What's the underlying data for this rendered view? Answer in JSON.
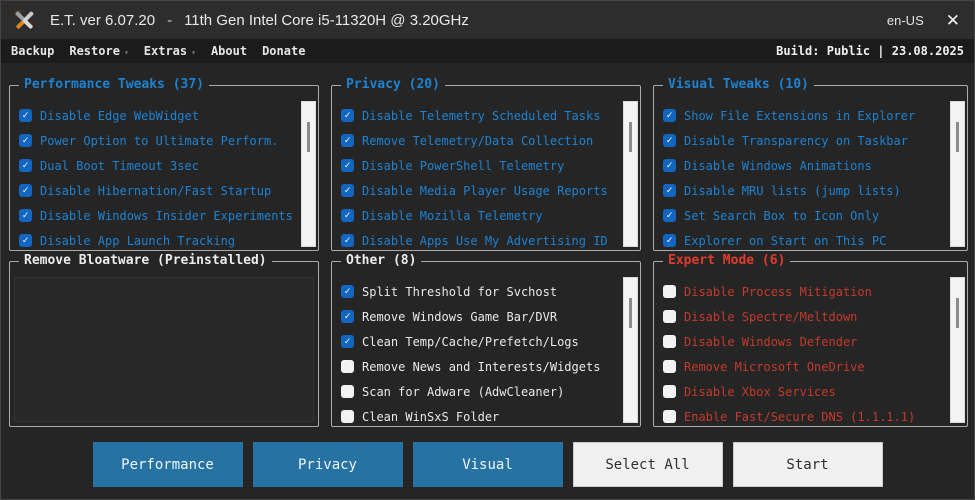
{
  "titlebar": {
    "app_title": "E.T. ver 6.07.20",
    "separator": "-",
    "cpu_info": "11th Gen Intel Core i5-11320H @ 3.20GHz",
    "language": "en-US",
    "close_icon": "✕",
    "app_icon": "crossed-tools-icon"
  },
  "menubar": {
    "items": [
      {
        "label": "Backup",
        "caret": ""
      },
      {
        "label": "Restore",
        "caret": "▾"
      },
      {
        "label": "Extras",
        "caret": "▾"
      },
      {
        "label": "About",
        "caret": ""
      },
      {
        "label": "Donate",
        "caret": ""
      }
    ],
    "build_info": "Build: Public | 23.08.2025"
  },
  "groups": [
    {
      "id": "performance-tweaks",
      "title": "Performance Tweaks (37)",
      "theme": "blue",
      "scrollbar": true,
      "listbox": false,
      "items": [
        {
          "label": "Disable Edge WebWidget",
          "checked": true
        },
        {
          "label": "Power Option to Ultimate Perform.",
          "checked": true
        },
        {
          "label": "Dual Boot Timeout 3sec",
          "checked": true
        },
        {
          "label": "Disable Hibernation/Fast Startup",
          "checked": true
        },
        {
          "label": "Disable Windows Insider Experiments",
          "checked": true
        },
        {
          "label": "Disable App Launch Tracking",
          "checked": true
        }
      ]
    },
    {
      "id": "privacy",
      "title": "Privacy (20)",
      "theme": "blue",
      "scrollbar": true,
      "listbox": false,
      "items": [
        {
          "label": "Disable Telemetry Scheduled Tasks",
          "checked": true
        },
        {
          "label": "Remove Telemetry/Data Collection",
          "checked": true
        },
        {
          "label": "Disable PowerShell Telemetry",
          "checked": true
        },
        {
          "label": "Disable Media Player Usage Reports",
          "checked": true
        },
        {
          "label": "Disable Mozilla Telemetry",
          "checked": true
        },
        {
          "label": "Disable Apps Use My Advertising ID",
          "checked": true
        }
      ]
    },
    {
      "id": "visual-tweaks",
      "title": "Visual Tweaks (10)",
      "theme": "blue",
      "scrollbar": true,
      "listbox": false,
      "items": [
        {
          "label": "Show File Extensions in Explorer",
          "checked": true
        },
        {
          "label": "Disable Transparency on Taskbar",
          "checked": true
        },
        {
          "label": "Disable Windows Animations",
          "checked": true
        },
        {
          "label": "Disable MRU lists (jump lists)",
          "checked": true
        },
        {
          "label": "Set Search Box to Icon Only",
          "checked": true
        },
        {
          "label": "Explorer on Start on This PC",
          "checked": true
        }
      ]
    },
    {
      "id": "remove-bloatware",
      "title": "Remove Bloatware (Preinstalled)",
      "theme": "white",
      "scrollbar": false,
      "listbox": true,
      "items": []
    },
    {
      "id": "other",
      "title": "Other (8)",
      "theme": "white",
      "scrollbar": true,
      "listbox": false,
      "items": [
        {
          "label": "Split Threshold for Svchost",
          "checked": true
        },
        {
          "label": "Remove Windows Game Bar/DVR",
          "checked": true
        },
        {
          "label": "Clean Temp/Cache/Prefetch/Logs",
          "checked": true
        },
        {
          "label": "Remove News and Interests/Widgets",
          "checked": false
        },
        {
          "label": "Scan for Adware (AdwCleaner)",
          "checked": false
        },
        {
          "label": "Clean WinSxS Folder",
          "checked": false
        }
      ]
    },
    {
      "id": "expert-mode",
      "title": "Expert Mode (6)",
      "theme": "red",
      "scrollbar": true,
      "listbox": false,
      "items": [
        {
          "label": "Disable Process Mitigation",
          "checked": false
        },
        {
          "label": "Disable Spectre/Meltdown",
          "checked": false
        },
        {
          "label": "Disable Windows Defender",
          "checked": false
        },
        {
          "label": "Remove Microsoft OneDrive",
          "checked": false
        },
        {
          "label": "Disable Xbox Services",
          "checked": false
        },
        {
          "label": "Enable Fast/Secure DNS (1.1.1.1)",
          "checked": false
        }
      ]
    }
  ],
  "action_buttons": [
    {
      "label": "Performance",
      "style": "blue"
    },
    {
      "label": "Privacy",
      "style": "blue"
    },
    {
      "label": "Visual",
      "style": "blue"
    },
    {
      "label": "Select All",
      "style": "light"
    },
    {
      "label": "Start",
      "style": "light"
    }
  ],
  "checkmark_glyph": "✓",
  "colors": {
    "accent_blue": "#1e82d2",
    "checkbox_checked": "#1266c0",
    "expert_title_red": "#e23b2d",
    "expert_item_red": "#c43a2c",
    "button_blue": "#2673a3",
    "window_bg": "#252525",
    "titlebar_bg": "#2d2d2d",
    "menubar_bg": "#1b1b1b"
  }
}
